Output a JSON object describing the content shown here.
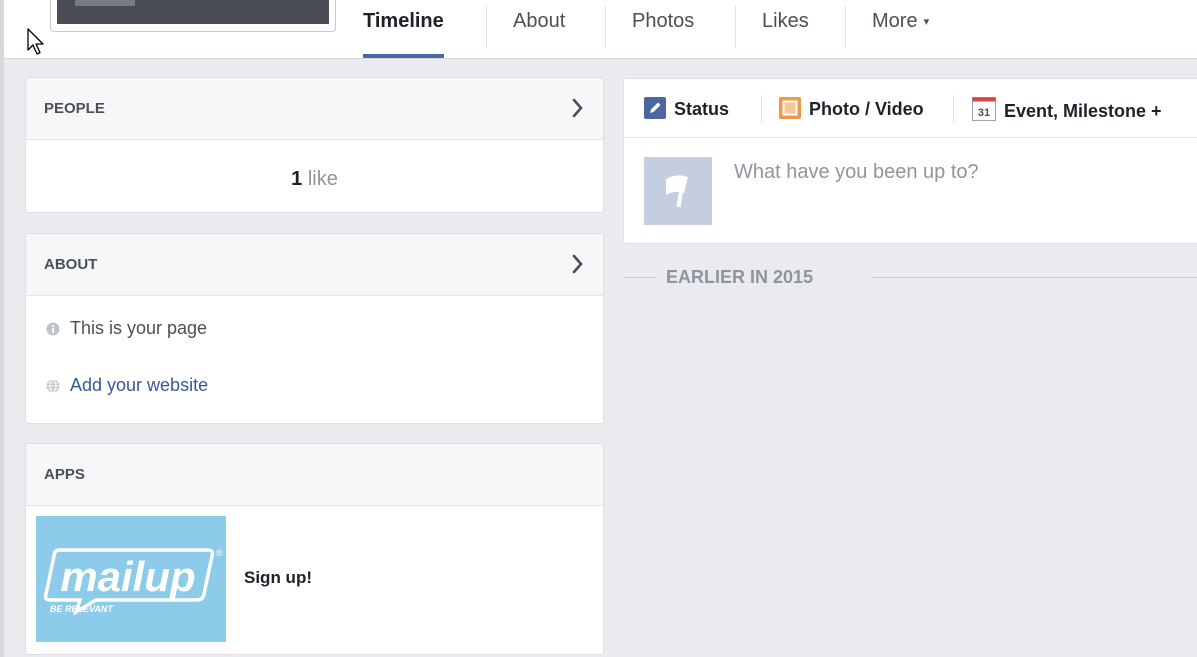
{
  "nav": {
    "tabs": [
      {
        "label": "Timeline",
        "active": true
      },
      {
        "label": "About"
      },
      {
        "label": "Photos"
      },
      {
        "label": "Likes"
      },
      {
        "label": "More"
      }
    ],
    "more_caret": "▾"
  },
  "people": {
    "title": "PEOPLE",
    "like_count": "1",
    "like_word": "like"
  },
  "about": {
    "title": "ABOUT",
    "items": [
      {
        "label": "This is your page",
        "icon": "info-icon"
      },
      {
        "label": "Add your website",
        "icon": "globe-icon",
        "link": true
      }
    ]
  },
  "apps": {
    "title": "APPS",
    "app_logo_text": "mailup",
    "app_logo_tagline": "BE RELEVANT",
    "app_logo_mark": "®",
    "app_label": "Sign up!"
  },
  "composer": {
    "tabs": [
      {
        "label": "Status",
        "icon": "pencil-icon"
      },
      {
        "label": "Photo / Video",
        "icon": "photo-icon"
      },
      {
        "label": "Event, Milestone +",
        "icon": "calendar-icon",
        "icon_text": "31"
      }
    ],
    "placeholder": "What have you been up to?"
  },
  "timeline": {
    "section_label": "EARLIER IN 2015"
  },
  "colors": {
    "accent": "#4b67a1",
    "page_bg": "#e9ebee",
    "card_header_bg": "#f6f7f9",
    "app_tile_bg": "#8ccbea",
    "link": "#365899"
  }
}
